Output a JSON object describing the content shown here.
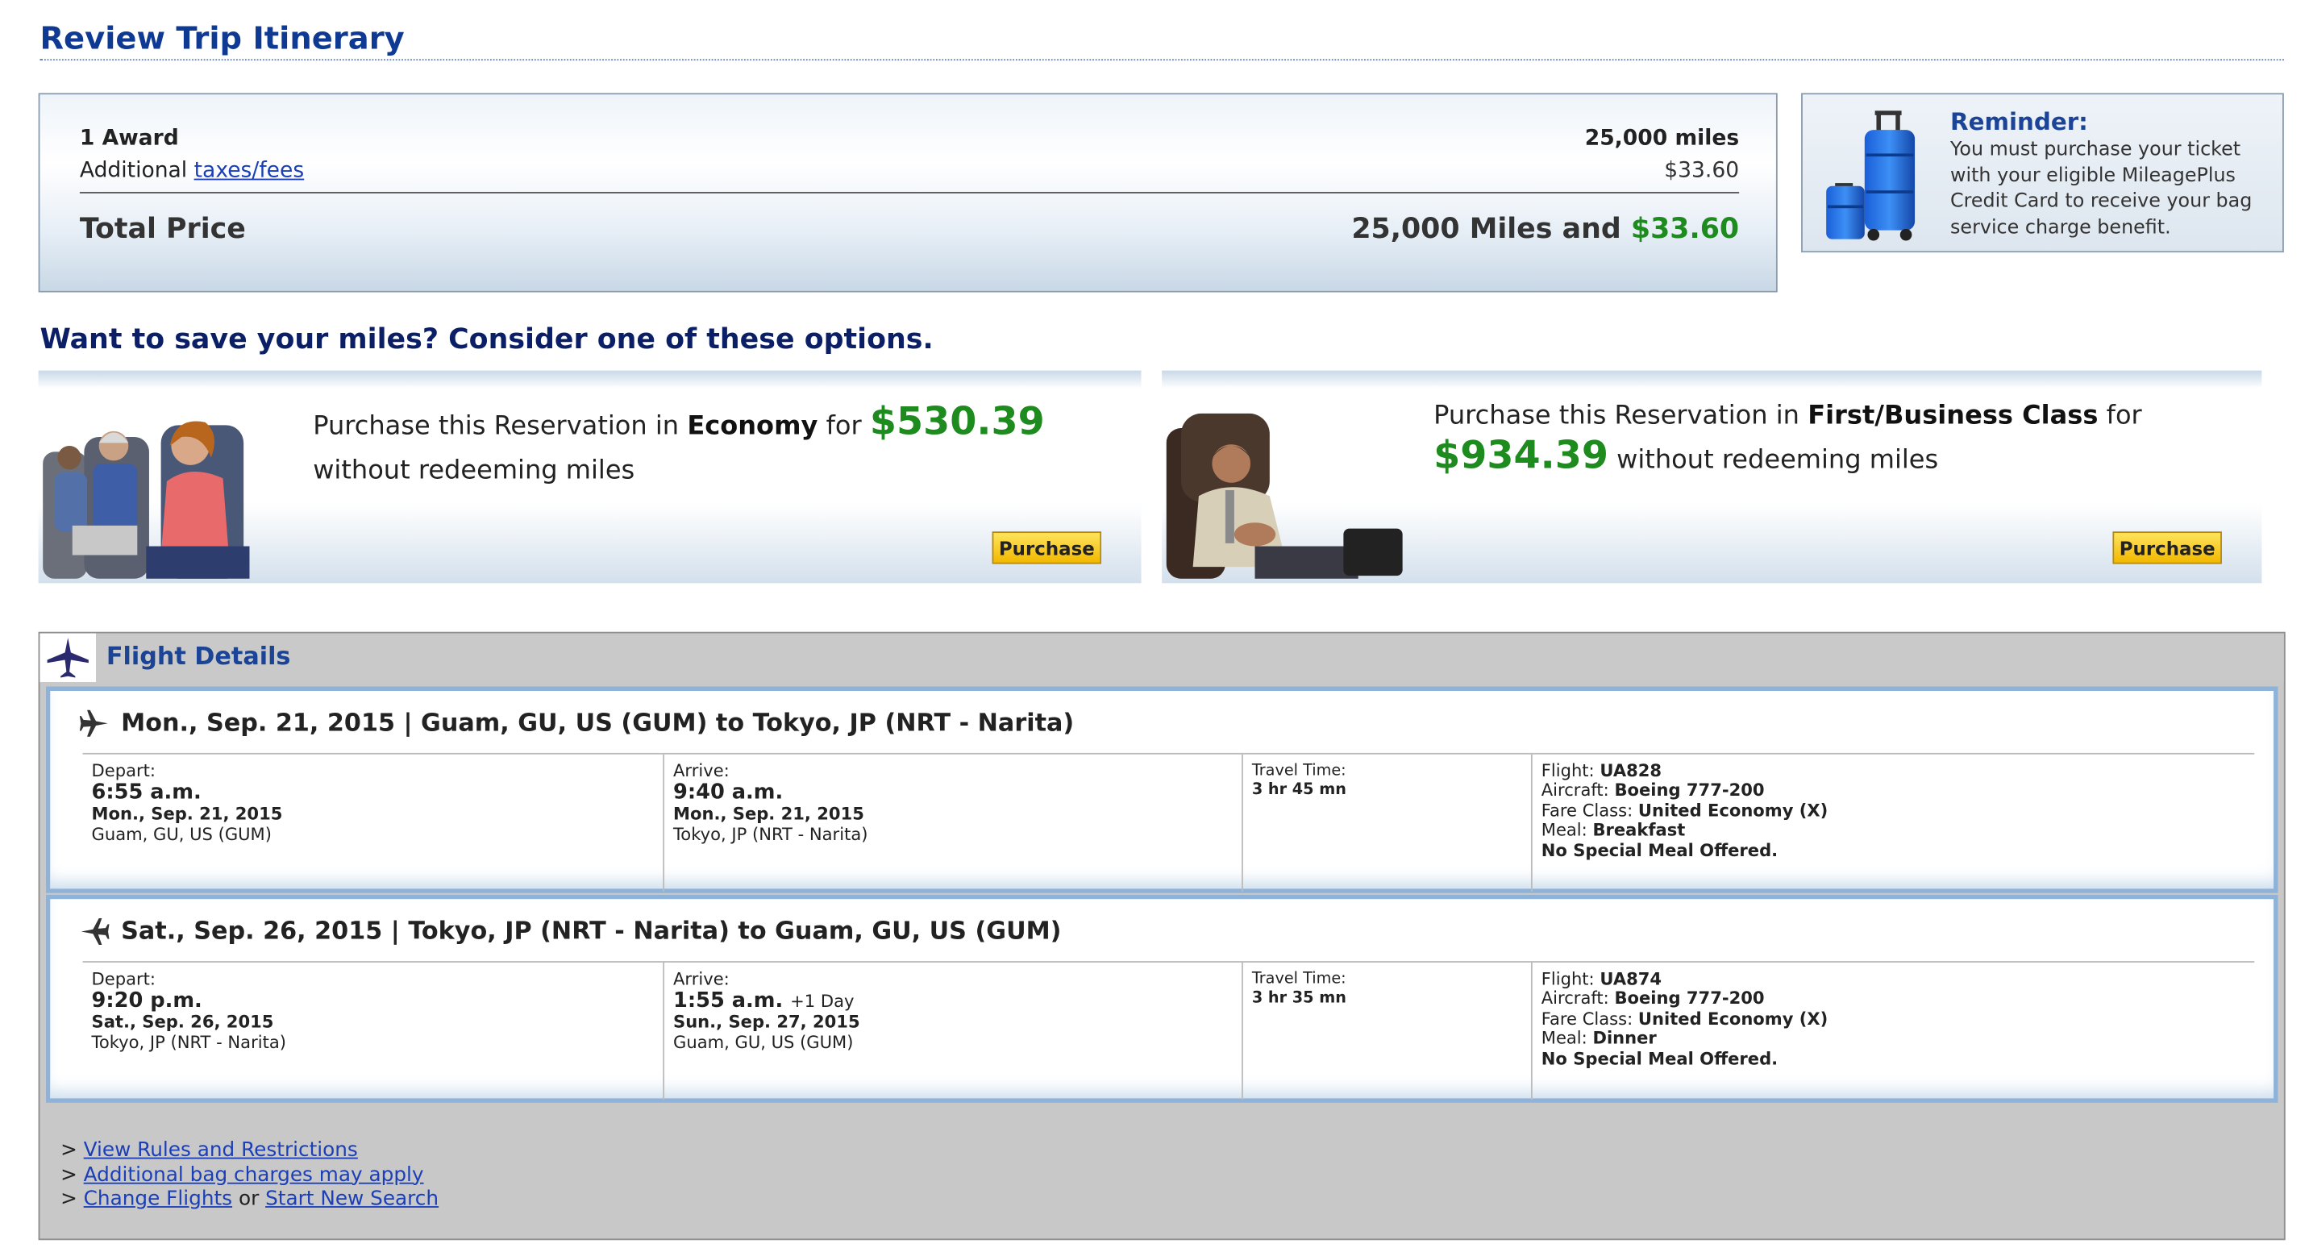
{
  "page_title": "Review Trip Itinerary",
  "price": {
    "award_label": "1 Award",
    "award_value": "25,000 miles",
    "fees_prefix": "Additional",
    "fees_link": "taxes/fees",
    "fees_value": "$33.60",
    "total_label": "Total Price",
    "total_miles": "25,000 Miles and",
    "total_cash": "$33.60"
  },
  "reminder": {
    "title": "Reminder:",
    "text": "You must purchase your ticket with your eligible MileagePlus Credit Card to receive your bag service charge benefit."
  },
  "save_heading": "Want to save your miles? Consider one of these options.",
  "offers": {
    "economy": {
      "prefix": "Purchase this Reservation in",
      "cabin": "Economy",
      "for": "for",
      "price": "$530.39",
      "suffix": "without redeeming miles",
      "button": "Purchase"
    },
    "first": {
      "prefix": "Purchase this Reservation in",
      "cabin": "First/Business Class",
      "for": "for",
      "price": "$934.39",
      "suffix": "without redeeming miles",
      "button": "Purchase"
    }
  },
  "flight_details": {
    "title": "Flight Details",
    "segments": [
      {
        "header": "Mon., Sep. 21, 2015 | Guam, GU, US (GUM) to Tokyo, JP (NRT - Narita)",
        "depart_label": "Depart:",
        "depart_time": "6:55 a.m.",
        "depart_date": "Mon., Sep. 21, 2015",
        "depart_place": "Guam, GU, US (GUM)",
        "arrive_label": "Arrive:",
        "arrive_time": "9:40 a.m.",
        "arrive_extra": "",
        "arrive_date": "Mon., Sep. 21, 2015",
        "arrive_place": "Tokyo, JP (NRT - Narita)",
        "travel_label": "Travel Time:",
        "travel_time": "3 hr 45 mn",
        "flight_label": "Flight:",
        "flight": "UA828",
        "aircraft_label": "Aircraft:",
        "aircraft": "Boeing 777-200",
        "fare_label": "Fare Class:",
        "fare": "United Economy (X)",
        "meal_label": "Meal:",
        "meal": "Breakfast",
        "special": "No Special Meal Offered."
      },
      {
        "header": "Sat., Sep. 26, 2015 | Tokyo, JP (NRT - Narita) to Guam, GU, US (GUM)",
        "depart_label": "Depart:",
        "depart_time": "9:20 p.m.",
        "depart_date": "Sat., Sep. 26, 2015",
        "depart_place": "Tokyo, JP (NRT - Narita)",
        "arrive_label": "Arrive:",
        "arrive_time": "1:55 a.m.",
        "arrive_extra": "+1 Day",
        "arrive_date": "Sun., Sep. 27, 2015",
        "arrive_place": "Guam, GU, US (GUM)",
        "travel_label": "Travel Time:",
        "travel_time": "3 hr 35 mn",
        "flight_label": "Flight:",
        "flight": "UA874",
        "aircraft_label": "Aircraft:",
        "aircraft": "Boeing 777-200",
        "fare_label": "Fare Class:",
        "fare": "United Economy (X)",
        "meal_label": "Meal:",
        "meal": "Dinner",
        "special": "No Special Meal Offered."
      }
    ],
    "links": {
      "bullet": ">",
      "rules": "View Rules and Restrictions",
      "bag": "Additional bag charges may apply",
      "change": "Change Flights",
      "or": "or",
      "new_search": "Start New Search"
    }
  }
}
